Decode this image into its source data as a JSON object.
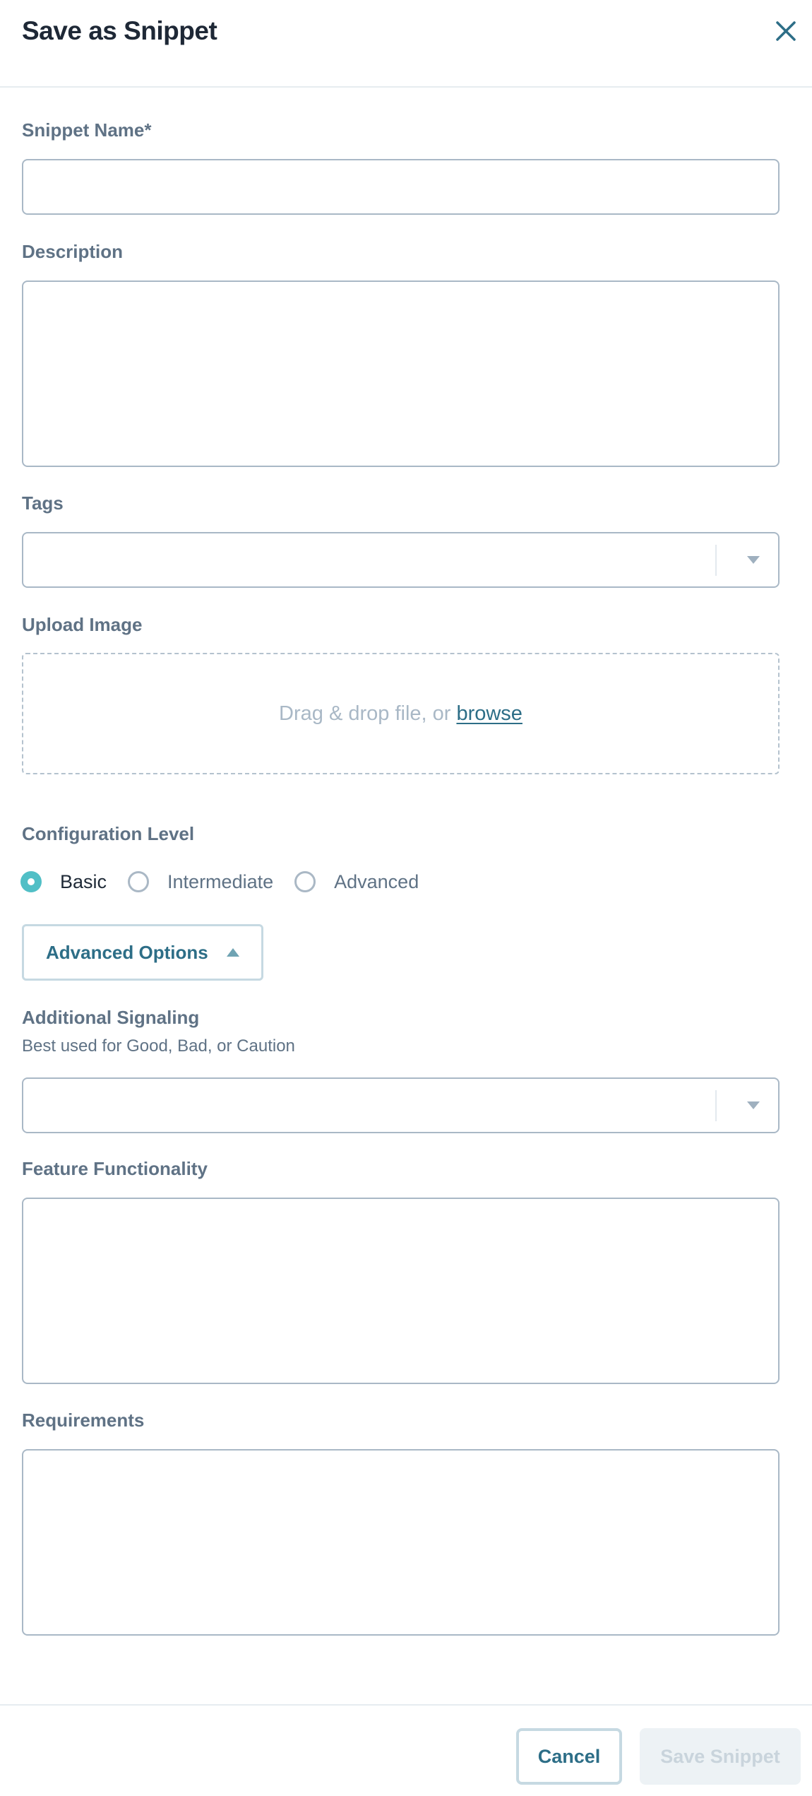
{
  "dialog": {
    "title": "Save as Snippet",
    "close_icon": "close-icon"
  },
  "form": {
    "snippet_name": {
      "label": "Snippet Name*",
      "value": "",
      "placeholder": ""
    },
    "description": {
      "label": "Description",
      "value": "",
      "placeholder": ""
    },
    "tags": {
      "label": "Tags",
      "selected": "",
      "icon": "chevron-down-icon"
    },
    "upload_image": {
      "label": "Upload Image",
      "prompt": "Drag & drop file, or",
      "browse_link": "browse"
    },
    "configuration_level": {
      "label": "Configuration Level",
      "options": [
        {
          "label": "Basic",
          "checked": true
        },
        {
          "label": "Intermediate",
          "checked": false
        },
        {
          "label": "Advanced",
          "checked": false
        }
      ]
    },
    "advanced_options": {
      "label": "Advanced Options",
      "expanded": true,
      "icon": "caret-up-icon"
    },
    "additional_signaling": {
      "label": "Additional Signaling",
      "helper": "Best used for Good, Bad, or Caution",
      "selected": "",
      "icon": "chevron-down-icon"
    },
    "feature_functionality": {
      "label": "Feature Functionality",
      "value": ""
    },
    "requirements": {
      "label": "Requirements",
      "value": ""
    }
  },
  "footer": {
    "cancel_label": "Cancel",
    "save_label": "Save Snippet",
    "save_disabled": true
  },
  "colors": {
    "accent": "#2d6e87",
    "radio_checked": "#51bfc6",
    "label": "#5f7285",
    "border": "#a9b8c6"
  }
}
